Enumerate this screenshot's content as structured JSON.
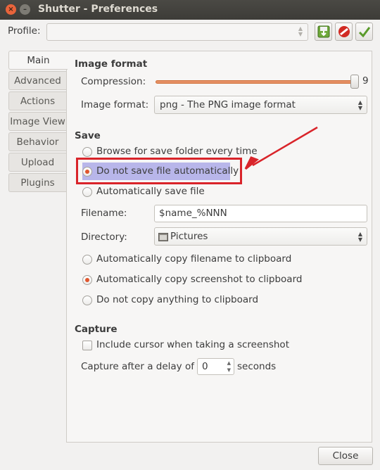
{
  "window": {
    "title": "Shutter - Preferences",
    "close_glyph": "×",
    "min_glyph": "–"
  },
  "profile": {
    "label": "Profile:",
    "value": ""
  },
  "toolbar": {
    "icons": [
      "save-profile-icon",
      "delete-profile-icon",
      "apply-profile-icon"
    ],
    "colors": {
      "save": "#6fa93a",
      "delete": "#d12a23",
      "apply": "#5a9a2a"
    }
  },
  "tabs": [
    {
      "label": "Main",
      "active": true
    },
    {
      "label": "Advanced"
    },
    {
      "label": "Actions"
    },
    {
      "label": "Image View"
    },
    {
      "label": "Behavior"
    },
    {
      "label": "Upload"
    },
    {
      "label": "Plugins"
    }
  ],
  "image_format": {
    "heading": "Image format",
    "compression_label": "Compression:",
    "compression_value": "9",
    "compression_level": 9,
    "compression_max": 9,
    "format_label": "Image format:",
    "format_value": "png - The PNG image format"
  },
  "save": {
    "heading": "Save",
    "options": [
      {
        "label": "Browse for save folder every time",
        "selected": false
      },
      {
        "label": "Do not save file automatically",
        "selected": true
      },
      {
        "label": "Automatically save file",
        "selected": false
      }
    ],
    "filename_label": "Filename:",
    "filename_value": "$name_%NNN",
    "directory_label": "Directory:",
    "directory_value": "Pictures",
    "clipboard_options": [
      {
        "label": "Automatically copy filename to clipboard",
        "selected": false
      },
      {
        "label": "Automatically copy screenshot to clipboard",
        "selected": true
      },
      {
        "label": "Do not copy anything to clipboard",
        "selected": false
      }
    ]
  },
  "capture": {
    "heading": "Capture",
    "include_cursor_label": "Include cursor when taking a screenshot",
    "include_cursor_checked": false,
    "delay_label": "Capture after a delay of",
    "delay_value": "0",
    "delay_unit": "seconds"
  },
  "annotation": {
    "highlight_color": "#d9242a",
    "arrow_color": "#d9242a"
  },
  "footer": {
    "close_label": "Close"
  },
  "accent": "#e0562e"
}
